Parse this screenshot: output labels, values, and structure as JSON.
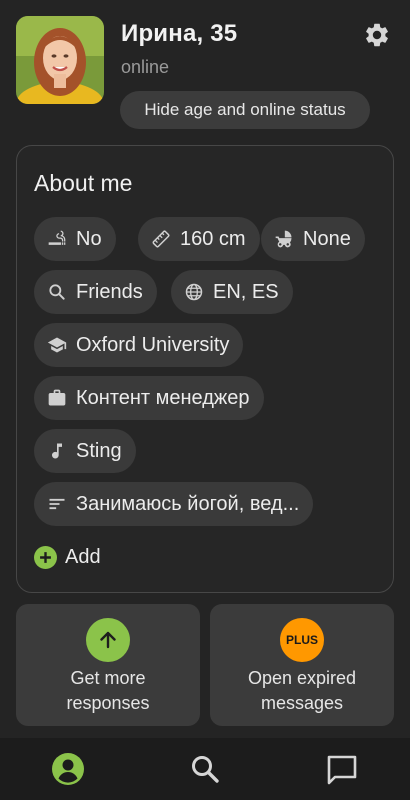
{
  "profile": {
    "name_age": "Ирина, 35",
    "status": "online",
    "hide_button": "Hide age and online status"
  },
  "about": {
    "title": "About me",
    "chips": [
      {
        "icon": "smoking-icon",
        "label": "No"
      },
      {
        "icon": "ruler-icon",
        "label": "160 cm"
      },
      {
        "icon": "stroller-icon",
        "label": "None"
      },
      {
        "icon": "search-icon",
        "label": "Friends"
      },
      {
        "icon": "globe-icon",
        "label": "EN, ES"
      },
      {
        "icon": "graduation-cap-icon",
        "label": "Oxford University"
      },
      {
        "icon": "briefcase-icon",
        "label": "Контент менеджер"
      },
      {
        "icon": "music-note-icon",
        "label": "Sting"
      },
      {
        "icon": "text-lines-icon",
        "label": "Занимаюсь йогой, вед..."
      }
    ],
    "add_label": "Add"
  },
  "actions": {
    "more_responses": {
      "line1": "Get more",
      "line2": "responses"
    },
    "expired": {
      "badge": "PLUS",
      "line1": "Open expired",
      "line2": "messages"
    }
  },
  "colors": {
    "accent_green": "#8bc34a",
    "plus_orange": "#ff9800",
    "background": "#242424"
  },
  "tabs": [
    {
      "icon": "profile-icon",
      "active": true
    },
    {
      "icon": "search-icon",
      "active": false
    },
    {
      "icon": "chat-icon",
      "active": false
    }
  ]
}
